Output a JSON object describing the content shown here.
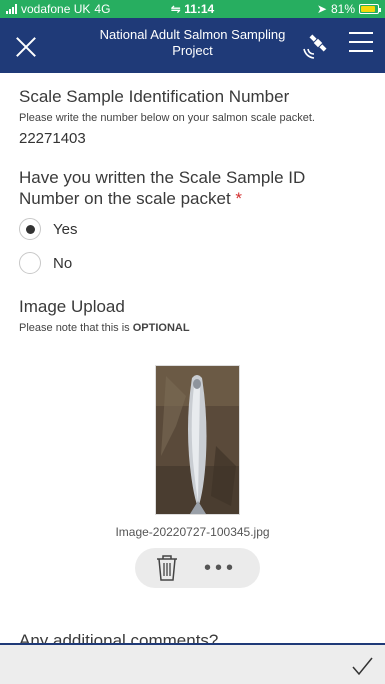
{
  "status_bar": {
    "carrier": "vodafone UK",
    "network": "4G",
    "time": "11:14",
    "battery_percent": "81%",
    "battery_level": 0.81,
    "background_color": "#27ae60"
  },
  "header": {
    "title": "National Adult Salmon Sampling Project",
    "background_color": "#1f3a78",
    "icons": [
      "close-icon",
      "gps-satellite-icon",
      "hamburger-menu-icon"
    ]
  },
  "scale_sample": {
    "label": "Scale Sample Identification Number",
    "hint": "Please write the number below on your salmon scale packet.",
    "value": "22271403"
  },
  "question": {
    "label": "Have you written the Scale Sample ID Number on the scale packet",
    "required_marker": "*",
    "options": [
      {
        "label": "Yes",
        "selected": true
      },
      {
        "label": "No",
        "selected": false
      }
    ]
  },
  "image_upload": {
    "label": "Image Upload",
    "hint_prefix": "Please note that this is ",
    "hint_emphasis": "OPTIONAL",
    "filename": "Image-20220727-100345.jpg",
    "more_label": "•••"
  },
  "next_question": {
    "label": "Any additional comments?"
  },
  "bottom_bar": {
    "submit_icon": "checkmark-icon"
  }
}
